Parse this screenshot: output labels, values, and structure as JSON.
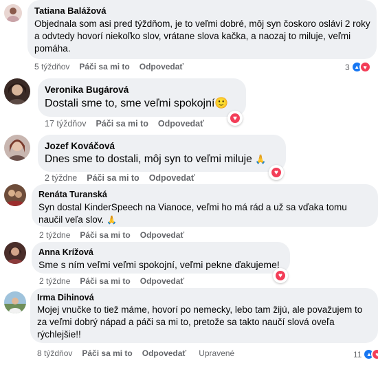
{
  "comments": [
    {
      "name": "Tatiana Balážová",
      "text": "Objednala som asi pred týždňom, je to veľmi dobré, môj syn čoskoro oslávi 2 roky a odvtedy hovorí niekoľko slov, vrátane slova kačka, a naozaj to miluje, veľmi pomáha.",
      "time": "5 týždňov",
      "like": "Páči sa mi to",
      "reply": "Odpovedať",
      "reaction_count": "3"
    },
    {
      "name": "Veronika Bugárová",
      "text": "Dostali sme to, sme veľmi spokojní",
      "emoji": "🙂",
      "time": "17 týždňov",
      "like": "Páči sa mi to",
      "reply": "Odpovedať"
    },
    {
      "name": "Jozef Kováčová",
      "text": "Dnes sme to dostali, môj syn to veľmi miluje",
      "emoji": "🙏",
      "time": "2 týždne",
      "like": "Páči sa mi to",
      "reply": "Odpovedať"
    },
    {
      "name": "Renáta Turanská",
      "text": "Syn dostal KinderSpeech na Vianoce, veľmi ho má rád a už sa vďaka tomu naučil veľa slov.",
      "emoji": "🙏",
      "time": "2 týždne",
      "like": "Páči sa mi to",
      "reply": "Odpovedať"
    },
    {
      "name": "Anna Krížová",
      "text": "Sme s ním veľmi veľmi spokojní, veľmi pekne ďakujeme!",
      "time": "2 týždne",
      "like": "Páči sa mi to",
      "reply": "Odpovedať"
    },
    {
      "name": "Irma Dihinová",
      "text": "Mojej vnučke to tiež máme, hovorí po nemecky, lebo tam žijú, ale považujem to za veľmi dobrý nápad a páči sa mi to, pretože sa takto naučí slová oveľa rýchlejšie!!",
      "time": "8 týždňov",
      "like": "Páči sa mi to",
      "reply": "Odpovedať",
      "edited": "Upravené",
      "reaction_count": "11"
    }
  ],
  "icons": {
    "heart": "heart-icon",
    "like": "thumbs-up-icon"
  },
  "colors": {
    "bubble": "#eef0f3",
    "heart": "#f33e58",
    "like": "#1877f2",
    "meta": "#65676b"
  }
}
